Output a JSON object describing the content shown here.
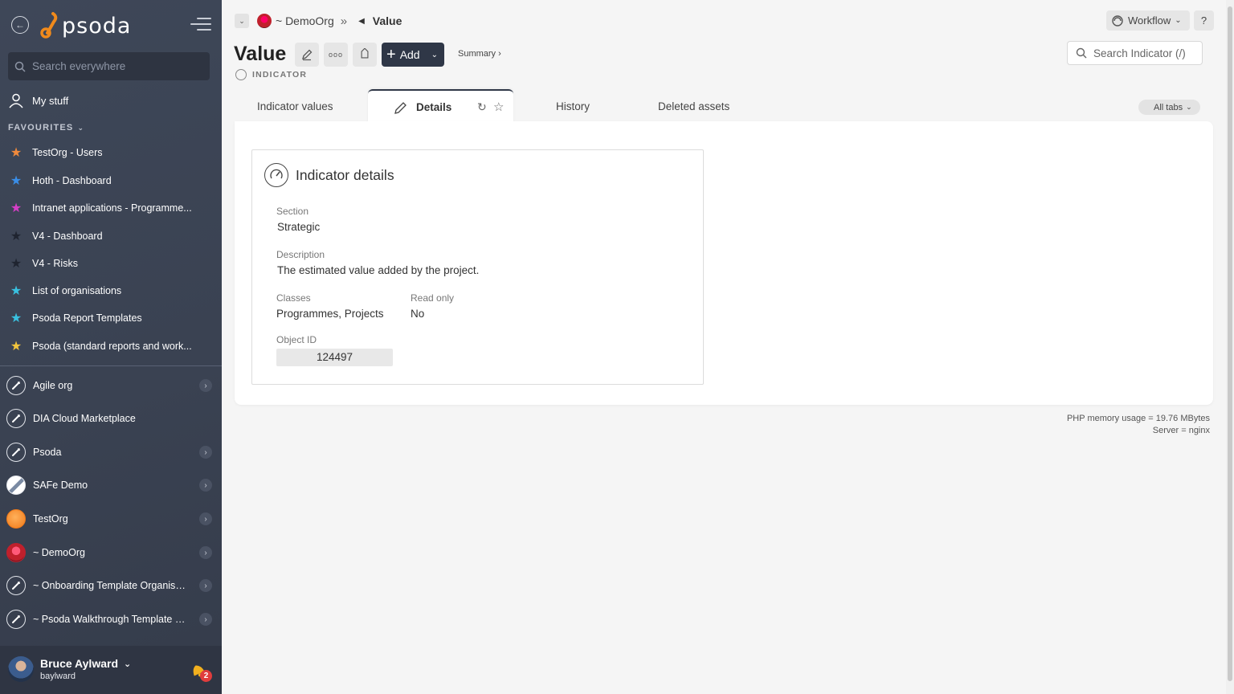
{
  "sidebar": {
    "logo_text": "psoda",
    "search_placeholder": "Search everywhere",
    "my_stuff": "My stuff",
    "favourites_header": "FAVOURITES",
    "favourites": [
      {
        "label": "TestOrg - Users",
        "color": "#f08a3c"
      },
      {
        "label": "Hoth - Dashboard",
        "color": "#3a8ee8"
      },
      {
        "label": "Intranet applications - Programme...",
        "color": "#d63ec7"
      },
      {
        "label": "V4 - Dashboard",
        "color": "#1f2430"
      },
      {
        "label": "V4 - Risks",
        "color": "#1f2430"
      },
      {
        "label": "List of organisations",
        "color": "#39c1e0"
      },
      {
        "label": "Psoda Report Templates",
        "color": "#39c1e0"
      },
      {
        "label": "Psoda (standard reports and work...",
        "color": "#f2c53d"
      }
    ],
    "orgs": [
      {
        "label": "Agile org",
        "icon": "rocket",
        "arrow": true
      },
      {
        "label": "DIA Cloud Marketplace",
        "icon": "rocket",
        "arrow": false
      },
      {
        "label": "Psoda",
        "icon": "rocket",
        "arrow": true
      },
      {
        "label": "SAFe Demo",
        "icon": "swoosh",
        "arrow": true
      },
      {
        "label": "TestOrg",
        "icon": "orange",
        "arrow": true
      },
      {
        "label": "~ DemoOrg",
        "icon": "red",
        "arrow": true
      },
      {
        "label": "~ Onboarding Template Organisa...",
        "icon": "rocket",
        "arrow": true
      },
      {
        "label": "~ Psoda Walkthrough Template P...",
        "icon": "rocket",
        "arrow": true
      }
    ],
    "user": {
      "name": "Bruce Aylward",
      "login": "baylward",
      "notifications": "2"
    }
  },
  "breadcrumb": {
    "org": "~ DemoOrg",
    "sep": "»",
    "current": "Value"
  },
  "header": {
    "title": "Value",
    "add_label": "Add",
    "summary_link": "Summary ›",
    "subtype": "INDICATOR",
    "search_placeholder": "Search Indicator (/)",
    "workflow_label": "Workflow",
    "help_label": "?"
  },
  "tabs": [
    {
      "label": "Indicator values"
    },
    {
      "label": "Details",
      "active": true
    },
    {
      "label": "History"
    },
    {
      "label": "Deleted assets"
    }
  ],
  "all_tabs_label": "All tabs",
  "card": {
    "title": "Indicator details",
    "section_label": "Section",
    "section_value": "Strategic",
    "description_label": "Description",
    "description_value": "The estimated value added by the project.",
    "classes_label": "Classes",
    "classes_value": "Programmes, Projects",
    "readonly_label": "Read only",
    "readonly_value": "No",
    "objectid_label": "Object ID",
    "objectid_value": "124497"
  },
  "footer": {
    "memory": "PHP memory usage = 19.76 MBytes",
    "server": "Server = nginx"
  }
}
